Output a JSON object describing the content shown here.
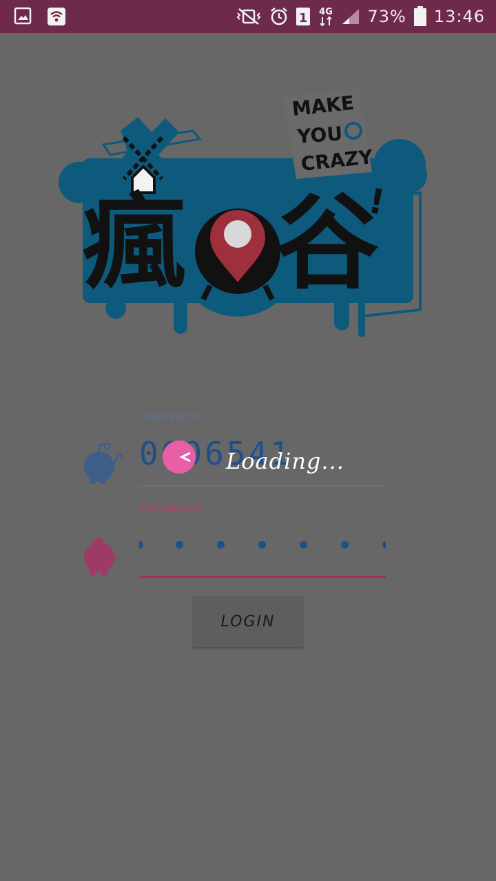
{
  "status_bar": {
    "battery": "73%",
    "time": "13:46",
    "network": "4G",
    "sim_slot": "1",
    "icons": [
      "image-icon",
      "wifi-icon",
      "vibrate-mute-icon",
      "alarm-icon",
      "sim-icon",
      "network-4g-icon",
      "signal-icon",
      "battery-icon"
    ],
    "bar_color": "#6e2a4a"
  },
  "logo": {
    "slogan_line1": "MAKE",
    "slogan_line2": "YOU",
    "slogan_line3": "CRAZY",
    "brand_chars": [
      "瘋",
      "",
      "谷"
    ],
    "exclamation": "!",
    "accent_blue": "#0e5a7c",
    "pin_red": "#9e2f3c"
  },
  "form": {
    "username_label": "UserName",
    "username_value": "0606541",
    "password_label": "Password",
    "login_label": "LOGIN",
    "username_color": "#1d4f8a",
    "password_accent": "#a8305e"
  },
  "overlay": {
    "loading_text": "Loading...",
    "spinner_color": "#e75fa7"
  }
}
